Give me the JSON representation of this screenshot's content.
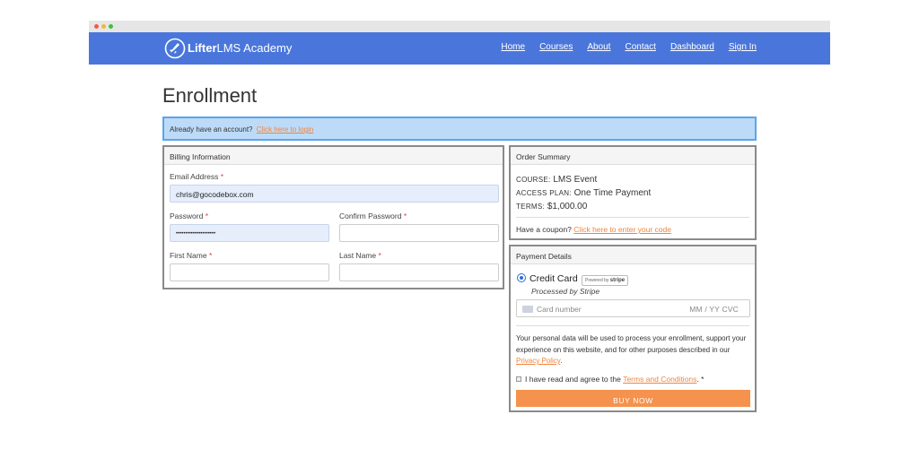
{
  "header": {
    "brand_bold": "Lifter",
    "brand_light": "LMS Academy",
    "nav": [
      "Home",
      "Courses",
      "About",
      "Contact",
      "Dashboard",
      "Sign In"
    ]
  },
  "page": {
    "title": "Enrollment"
  },
  "notice": {
    "text": "Already have an account?",
    "link": "Click here to login"
  },
  "billing": {
    "title": "Billing Information",
    "email_label": "Email Address",
    "email_value": "chris@gocodebox.com",
    "password_label": "Password",
    "password_value": "•••••••••••••••••••••",
    "confirm_label": "Confirm Password",
    "first_label": "First Name",
    "last_label": "Last Name",
    "required_mark": "*"
  },
  "summary": {
    "title": "Order Summary",
    "course_caption": "COURSE:",
    "course_value": "LMS Event",
    "plan_caption": "ACCESS PLAN:",
    "plan_value": "One Time Payment",
    "terms_caption": "TERMS:",
    "terms_value": "$1,000.00",
    "coupon_text": "Have a coupon?",
    "coupon_link": "Click here to enter your code"
  },
  "payment": {
    "title": "Payment Details",
    "method_label": "Credit Card",
    "badge_text": "Powered by",
    "badge_brand": "stripe",
    "processed_by": "Processed by Stripe",
    "card_placeholder": "Card number",
    "expiry_placeholder": "MM / YY  CVC",
    "privacy_text": "Your personal data will be used to process your enrollment, support your experience on this website, and for other purposes described in our",
    "privacy_link": "Privacy Policy",
    "privacy_end": ".",
    "agree_text": "I have read and agree to the",
    "terms_link": "Terms and Conditions",
    "terms_end": ". *",
    "buy_label": "BUY NOW"
  },
  "colors": {
    "header_bg": "#4a76dc",
    "accent_link": "#f0843d",
    "buy_button": "#f5924d",
    "notice_bg": "#bddbf8"
  }
}
